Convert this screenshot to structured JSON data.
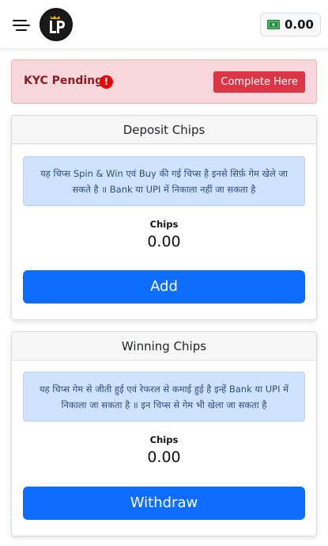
{
  "header": {
    "wallet_balance": "0.00"
  },
  "kyc": {
    "title": "KYC Pending",
    "badge": "!",
    "button_label": "Complete Here"
  },
  "deposit": {
    "title": "Deposit Chips",
    "info": "यह चिप्स Spin & Win एवं Buy की गई चिप्स है इनसे सिर्फ़ गेम खेले जा सकते है ॥ Bank या UPI में निकाला नहीं जा सकता है",
    "chips_label": "Chips",
    "chips_value": "0.00",
    "button_label": "Add"
  },
  "winning": {
    "title": "Winning Chips",
    "info": "यह चिप्स गेम से जीती हुई एवं रेफरल से कमाई हुई है इन्हें Bank या UPI में निकाला जा सकता है ॥ इन चिप्स से गेम भी खेला जा सकता है",
    "chips_label": "Chips",
    "chips_value": "0.00",
    "button_label": "Withdraw"
  },
  "colors": {
    "primary": "#0d6efd",
    "danger": "#dc3545",
    "wallet_icon": "#1f8a3b"
  }
}
